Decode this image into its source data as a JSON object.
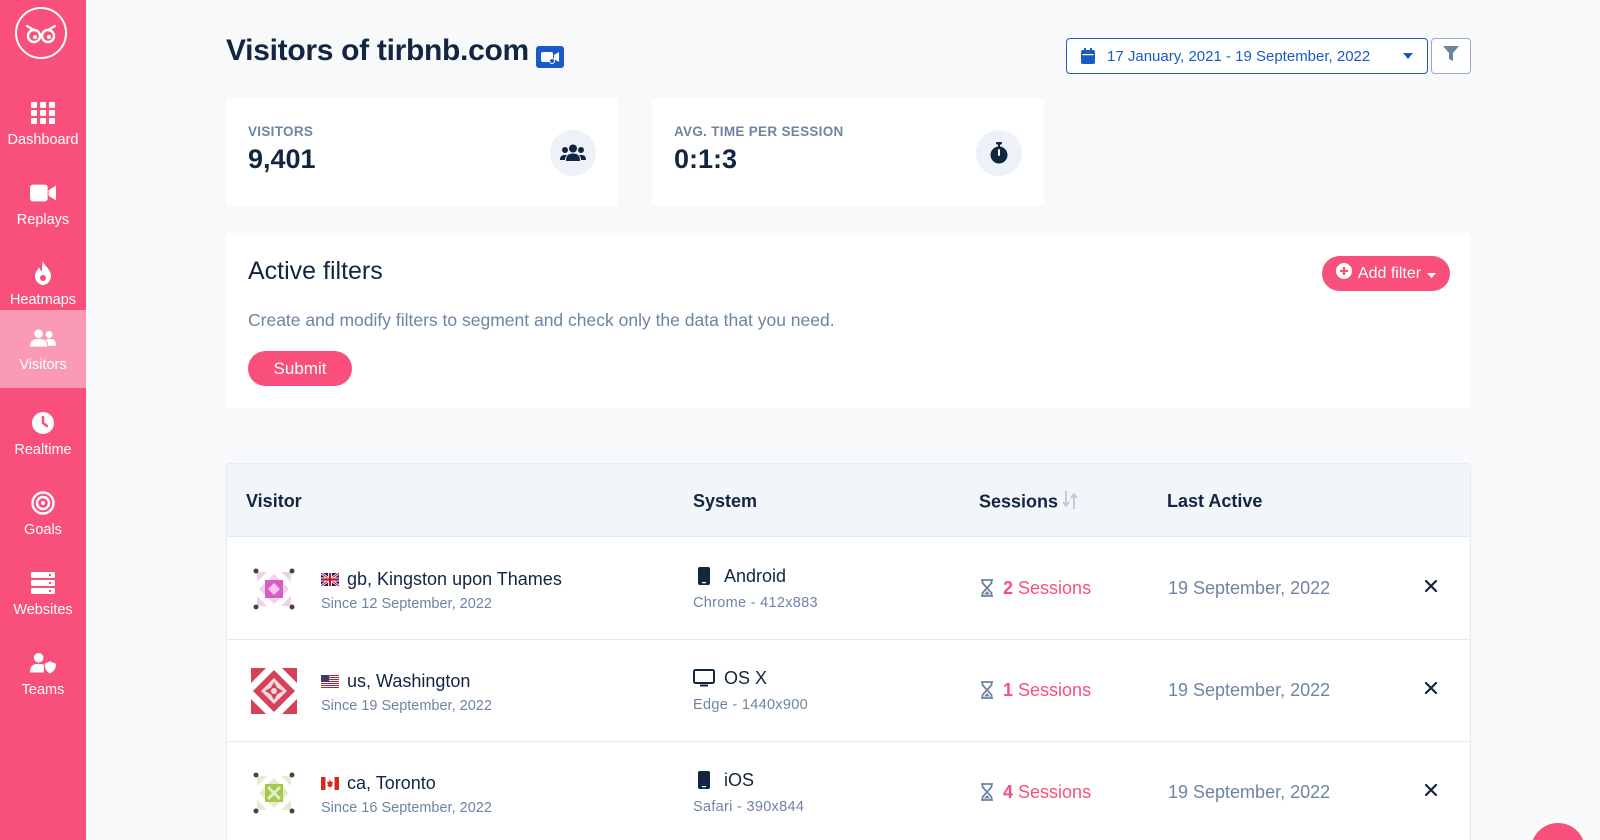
{
  "sidebar": {
    "items": [
      {
        "label": "Dashboard",
        "icon": "grid-icon"
      },
      {
        "label": "Replays",
        "icon": "video-icon"
      },
      {
        "label": "Heatmaps",
        "icon": "flame-icon"
      },
      {
        "label": "Visitors",
        "icon": "users-icon",
        "active": true
      },
      {
        "label": "Realtime",
        "icon": "clock-icon"
      },
      {
        "label": "Goals",
        "icon": "target-icon"
      },
      {
        "label": "Websites",
        "icon": "server-icon"
      },
      {
        "label": "Teams",
        "icon": "user-shield-icon"
      }
    ]
  },
  "header": {
    "title": "Visitors of tirbnb.com",
    "date_range": "17 January, 2021 - 19 September, 2022"
  },
  "stats": {
    "visitors": {
      "label": "VISITORS",
      "value": "9,401"
    },
    "avg_time": {
      "label": "AVG. TIME PER SESSION",
      "value": "0:1:3"
    }
  },
  "filters": {
    "title": "Active filters",
    "description": "Create and modify filters to segment and check only the data that you need.",
    "submit_label": "Submit",
    "add_filter_label": "Add filter"
  },
  "table": {
    "headers": {
      "visitor": "Visitor",
      "system": "System",
      "sessions": "Sessions",
      "last_active": "Last Active"
    },
    "rows": [
      {
        "flag": "gb",
        "location": "gb, Kingston upon Thames",
        "since": "Since 12 September, 2022",
        "os": "Android",
        "device": "mobile",
        "detail": "Chrome - 412x883",
        "sessions_count": "2",
        "sessions_label": "Sessions",
        "last_active": "19 September, 2022"
      },
      {
        "flag": "us",
        "location": "us, Washington",
        "since": "Since 19 September, 2022",
        "os": "OS X",
        "device": "desktop",
        "detail": "Edge - 1440x900",
        "sessions_count": "1",
        "sessions_label": "Sessions",
        "last_active": "19 September, 2022"
      },
      {
        "flag": "ca",
        "location": "ca, Toronto",
        "since": "Since 16 September, 2022",
        "os": "iOS",
        "device": "mobile",
        "detail": "Safari - 390x844",
        "sessions_count": "4",
        "sessions_label": "Sessions",
        "last_active": "19 September, 2022"
      }
    ]
  },
  "colors": {
    "brand": "#f8507a",
    "accent": "#1a5ac8",
    "text": "#12263f",
    "muted": "#6e84a3"
  }
}
